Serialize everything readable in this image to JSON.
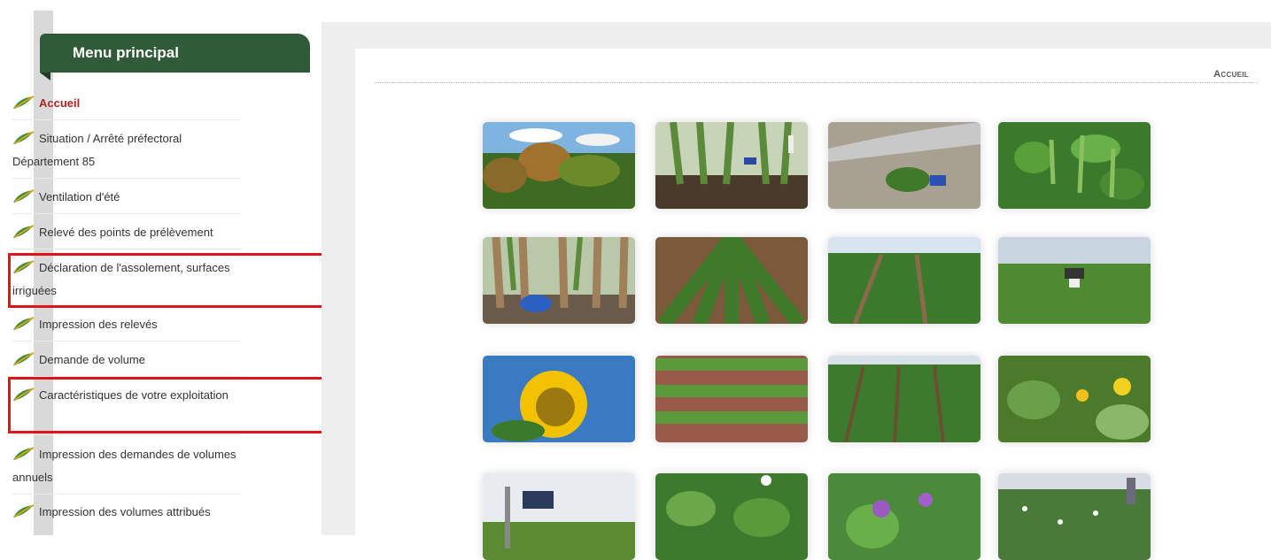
{
  "sidebar": {
    "title": "Menu principal",
    "items": [
      {
        "label": "Accueil",
        "active": true
      },
      {
        "label": "Situation / Arrêté préfectoral Département 85"
      },
      {
        "label": "Ventilation d'été"
      },
      {
        "label": "Relevé des points de prélèvement"
      },
      {
        "label": "Déclaration de l'assolement, surfaces irriguées",
        "highlighted": true
      },
      {
        "label": "Impression des relevés"
      },
      {
        "label": "Demande de volume"
      },
      {
        "label": "Caractéristiques de votre exploitation",
        "highlighted": true
      },
      {
        "label": "Impression des demandes de volumes annuels"
      },
      {
        "label": "Impression des volumes attribués"
      }
    ]
  },
  "breadcrumb": "Accueil",
  "colors": {
    "menu_header": "#2f5b39",
    "active_link": "#b22222",
    "highlight": "#e0141c"
  },
  "gallery": {
    "photos": [
      {
        "subject": "sorghum-field"
      },
      {
        "subject": "corn-rows-with-sensor"
      },
      {
        "subject": "seedling-with-irrigation-pipe"
      },
      {
        "subject": "pea-pods"
      },
      {
        "subject": "corn-stalks-with-tank"
      },
      {
        "subject": "crop-rows-1"
      },
      {
        "subject": "crop-rows-2"
      },
      {
        "subject": "field-with-solar-sensor"
      },
      {
        "subject": "sunflower"
      },
      {
        "subject": "onion-rows"
      },
      {
        "subject": "crop-rows-3"
      },
      {
        "subject": "squash-flowers"
      },
      {
        "subject": "solar-panel-station"
      },
      {
        "subject": "crop-with-probe"
      },
      {
        "subject": "purple-flowers"
      },
      {
        "subject": "field-with-person"
      }
    ]
  }
}
